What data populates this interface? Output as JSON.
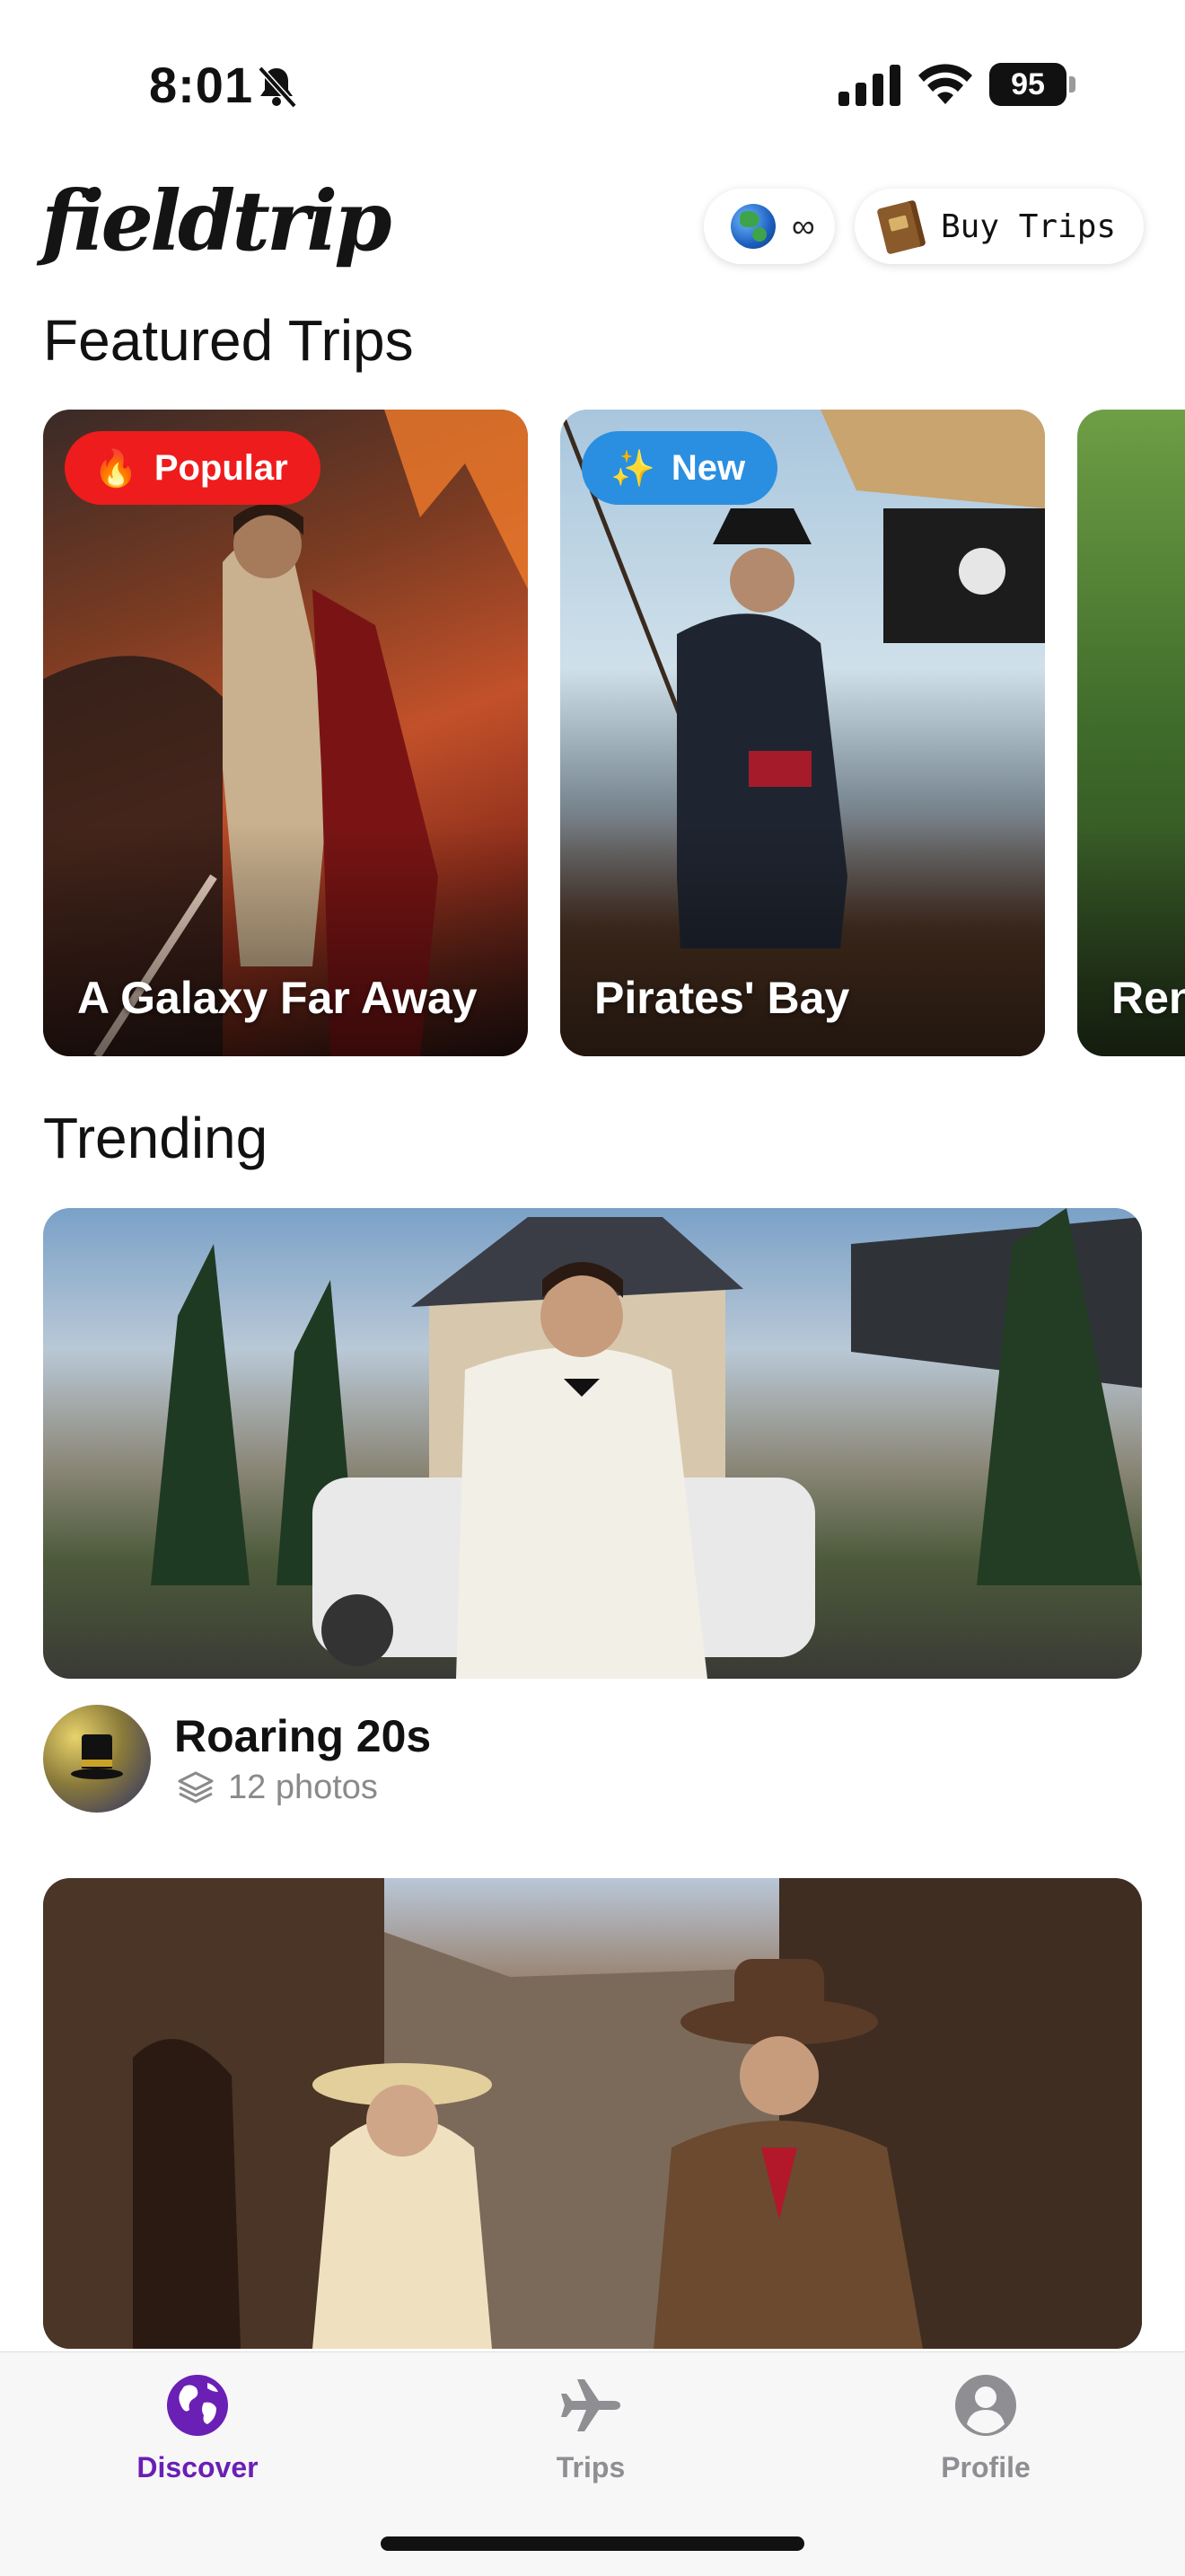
{
  "status_bar": {
    "time": "8:01",
    "battery": "95"
  },
  "header": {
    "logo": "fieldtrip",
    "trips_pill_value": "∞",
    "buy_label": "Buy Trips"
  },
  "featured": {
    "title": "Featured Trips",
    "cards": [
      {
        "title": "A Galaxy Far Away",
        "badge": "Popular",
        "badge_icon": "🔥",
        "badge_color": "#ee1c1c"
      },
      {
        "title": "Pirates' Bay",
        "badge": "New",
        "badge_icon": "✨",
        "badge_color": "#2a8fe0"
      },
      {
        "title": "Ren"
      }
    ]
  },
  "trending": {
    "title": "Trending",
    "items": [
      {
        "name": "Roaring 20s",
        "meta": "12 photos"
      }
    ]
  },
  "tabbar": {
    "tabs": [
      {
        "label": "Discover",
        "icon": "globe-icon",
        "active": true
      },
      {
        "label": "Trips",
        "icon": "airplane-icon",
        "active": false
      },
      {
        "label": "Profile",
        "icon": "person-icon",
        "active": false
      }
    ],
    "accent": "#6a1fb5",
    "inactive": "#8e8e93"
  }
}
